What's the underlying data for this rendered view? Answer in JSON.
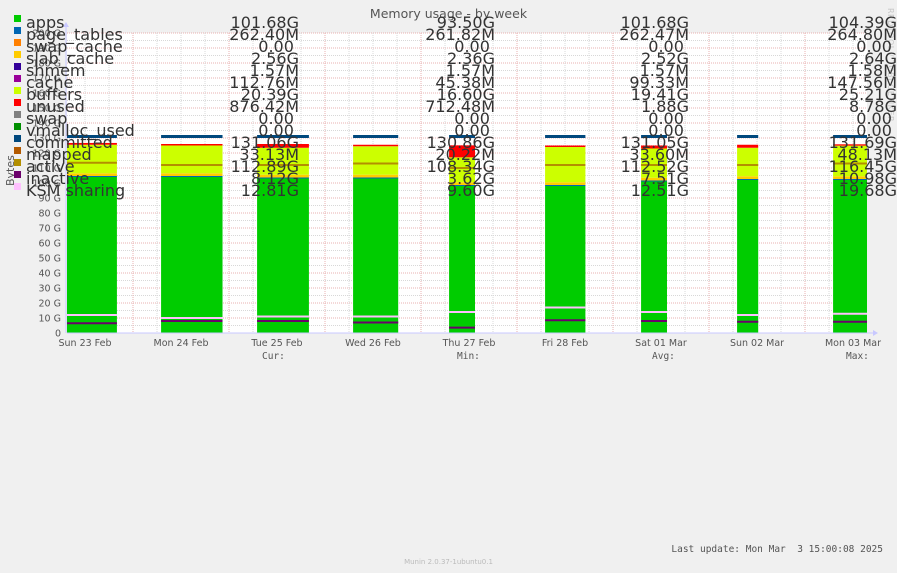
{
  "chart_data": {
    "type": "area",
    "title": "Memory usage - by week",
    "ylabel": "Bytes",
    "xlabel": "",
    "ylim": [
      0,
      200
    ],
    "yunit": "G",
    "yticks": [
      "0",
      "10 G",
      "20 G",
      "30 G",
      "40 G",
      "50 G",
      "60 G",
      "70 G",
      "80 G",
      "90 G",
      "100 G",
      "110 G",
      "120 G",
      "130 G",
      "140 G",
      "150 G",
      "160 G",
      "170 G",
      "180 G",
      "190 G",
      "200 G"
    ],
    "xticks": [
      "Sun 23 Feb",
      "Mon 24 Feb",
      "Tue 25 Feb",
      "Wed 26 Feb",
      "Thu 27 Feb",
      "Fri 28 Feb",
      "Sat 01 Mar",
      "Sun 02 Mar",
      "Mon 03 Mar"
    ],
    "grid": true,
    "segments": [
      {
        "day": "Sun 23 Feb",
        "start": 0.0,
        "end": 0.52,
        "apps": 104,
        "slab": 2.5,
        "buffers": 19,
        "unused": 1.2,
        "committed": 131,
        "active": 113.5,
        "inactive": 6.5,
        "ksm": 12
      },
      {
        "day": "Mon 24 Feb",
        "start": 0.98,
        "end": 1.62,
        "apps": 104,
        "slab": 2.5,
        "buffers": 18.5,
        "unused": 1.0,
        "committed": 131,
        "active": 112,
        "inactive": 8,
        "ksm": 10
      },
      {
        "day": "Tue 25 Feb",
        "start": 1.98,
        "end": 2.52,
        "apps": 103,
        "slab": 2.5,
        "buffers": 18,
        "unused": 2.5,
        "committed": 131,
        "active": 112,
        "inactive": 8,
        "ksm": 11
      },
      {
        "day": "Wed 26 Feb",
        "start": 2.98,
        "end": 3.45,
        "apps": 103,
        "slab": 2.5,
        "buffers": 19,
        "unused": 1.0,
        "committed": 131,
        "active": 113,
        "inactive": 7,
        "ksm": 11
      },
      {
        "day": "Thu 27 Feb",
        "start": 3.98,
        "end": 4.25,
        "apps": 98,
        "slab": 2.5,
        "buffers": 16.6,
        "unused": 8.0,
        "committed": 131,
        "active": 110,
        "inactive": 3.6,
        "ksm": 14
      },
      {
        "day": "Fri 28 Feb",
        "start": 4.98,
        "end": 5.4,
        "apps": 98,
        "slab": 2.5,
        "buffers": 23.5,
        "unused": 1.0,
        "committed": 131,
        "active": 112,
        "inactive": 8.5,
        "ksm": 17
      },
      {
        "day": "Sat 01 Mar",
        "start": 5.98,
        "end": 6.25,
        "apps": 101,
        "slab": 2.5,
        "buffers": 19.5,
        "unused": 2.0,
        "committed": 131,
        "active": 112,
        "inactive": 8,
        "ksm": 14
      },
      {
        "day": "Sun 02 Mar",
        "start": 6.98,
        "end": 7.2,
        "apps": 102,
        "slab": 2.5,
        "buffers": 19,
        "unused": 2.0,
        "committed": 131,
        "active": 112,
        "inactive": 7.5,
        "ksm": 12
      },
      {
        "day": "Mon 03 Mar",
        "start": 7.98,
        "end": 8.36,
        "apps": 102,
        "slab": 2.5,
        "buffers": 20.4,
        "unused": 0.9,
        "committed": 131,
        "active": 113,
        "inactive": 7.5,
        "ksm": 12.8
      }
    ],
    "series_colors": {
      "apps": "#00cc00",
      "page_tables": "#0066b3",
      "swap_cache": "#ff8000",
      "slab_cache": "#ffcc00",
      "shmem": "#330099",
      "cache": "#990099",
      "buffers": "#ccff00",
      "unused": "#ff0000",
      "swap": "#808080",
      "vmalloc_used": "#008f00",
      "committed": "#00487d",
      "mapped": "#b35a00",
      "active": "#b38f00",
      "inactive": "#6b006b",
      "ksm": "#ffc0ff"
    }
  },
  "legend": {
    "headers": {
      "cur": "Cur:",
      "min": "Min:",
      "avg": "Avg:",
      "max": "Max:"
    },
    "rows": [
      {
        "name": "apps",
        "color": "#00cc00",
        "cur": "101.68G",
        "min": "93.50G",
        "avg": "101.68G",
        "max": "104.39G"
      },
      {
        "name": "page_tables",
        "color": "#0066b3",
        "cur": "262.40M",
        "min": "261.82M",
        "avg": "262.47M",
        "max": "264.80M"
      },
      {
        "name": "swap_cache",
        "color": "#ff8000",
        "cur": "0.00 ",
        "min": "0.00 ",
        "avg": "0.00 ",
        "max": "0.00 "
      },
      {
        "name": "slab_cache",
        "color": "#ffcc00",
        "cur": "2.56G",
        "min": "2.36G",
        "avg": "2.52G",
        "max": "2.64G"
      },
      {
        "name": "shmem",
        "color": "#330099",
        "cur": "1.57M",
        "min": "1.57M",
        "avg": "1.57M",
        "max": "1.58M"
      },
      {
        "name": "cache",
        "color": "#990099",
        "cur": "112.76M",
        "min": "45.38M",
        "avg": "99.33M",
        "max": "147.56M"
      },
      {
        "name": "buffers",
        "color": "#ccff00",
        "cur": "20.39G",
        "min": "16.60G",
        "avg": "19.41G",
        "max": "25.21G"
      },
      {
        "name": "unused",
        "color": "#ff0000",
        "cur": "876.42M",
        "min": "712.48M",
        "avg": "1.88G",
        "max": "8.78G"
      },
      {
        "name": "swap",
        "color": "#808080",
        "cur": "0.00 ",
        "min": "0.00 ",
        "avg": "0.00 ",
        "max": "0.00 "
      },
      {
        "name": "vmalloc_used",
        "color": "#008f00",
        "cur": "0.00 ",
        "min": "0.00 ",
        "avg": "0.00 ",
        "max": "0.00 "
      },
      {
        "name": "committed",
        "color": "#00487d",
        "cur": "131.06G",
        "min": "130.86G",
        "avg": "131.05G",
        "max": "131.69G"
      },
      {
        "name": "mapped",
        "color": "#b35a00",
        "cur": "33.13M",
        "min": "20.22M",
        "avg": "33.60M",
        "max": "48.13M"
      },
      {
        "name": "active",
        "color": "#b38f00",
        "cur": "112.89G",
        "min": "108.34G",
        "avg": "112.52G",
        "max": "116.45G"
      },
      {
        "name": "inactive",
        "color": "#6b006b",
        "cur": "8.12G",
        "min": "3.62G",
        "avg": "7.51G",
        "max": "10.98G"
      },
      {
        "name": "KSM sharing",
        "color": "#ffc0ff",
        "cur": "12.81G",
        "min": "9.60G",
        "avg": "12.51G",
        "max": "19.68G"
      }
    ]
  },
  "last_update": "Last update: Mon Mar  3 15:00:08 2025",
  "watermark": "RRDTOOL / TOBI OETIKER",
  "footer": "Munin 2.0.37-1ubuntu0.1"
}
